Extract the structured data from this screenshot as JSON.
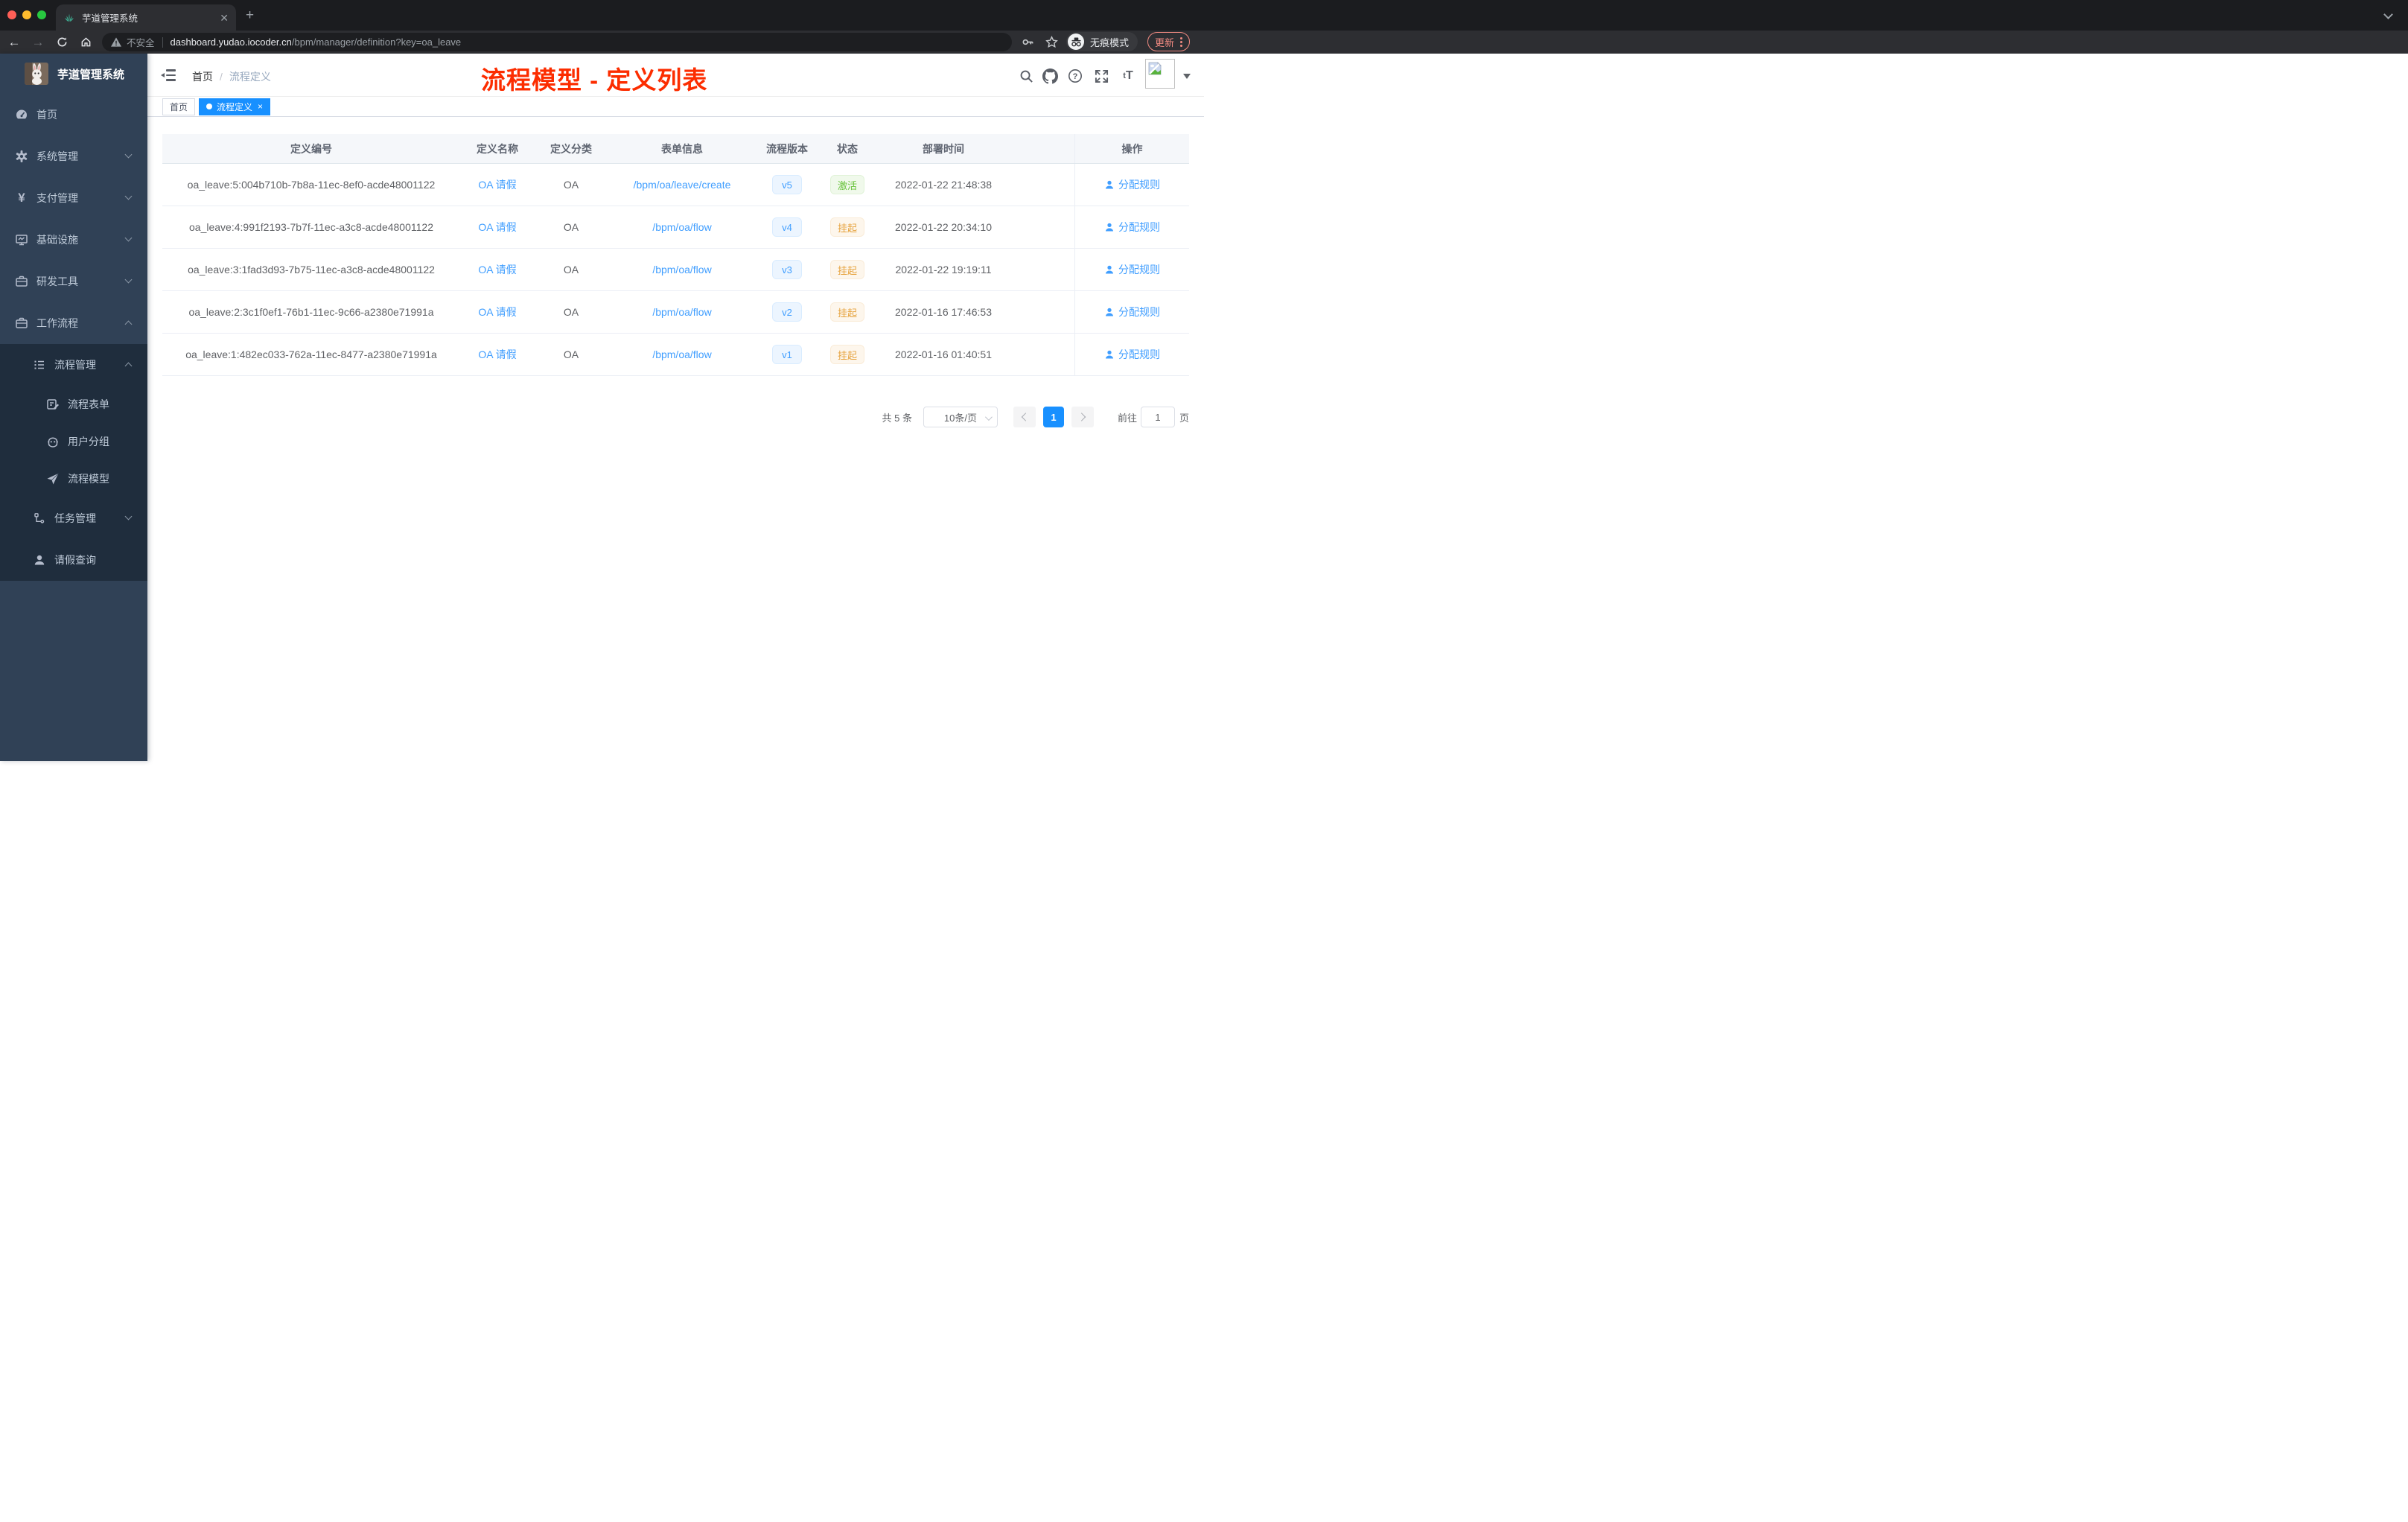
{
  "browser": {
    "tab_title": "芋道管理系统",
    "new_tab": "+",
    "security_label": "不安全",
    "url_host": "dashboard.yudao.iocoder.cn",
    "url_path": "/bpm/manager/definition?key=oa_leave",
    "incognito_label": "无痕模式",
    "update_label": "更新"
  },
  "sidebar": {
    "brand": "芋道管理系统",
    "items": [
      {
        "label": "首页",
        "icon": "dashboard-icon",
        "level": 1
      },
      {
        "label": "系统管理",
        "icon": "gear-icon",
        "level": 1,
        "chevron": "down"
      },
      {
        "label": "支付管理",
        "icon": "yen-icon",
        "level": 1,
        "chevron": "down"
      },
      {
        "label": "基础设施",
        "icon": "monitor-icon",
        "level": 1,
        "chevron": "down"
      },
      {
        "label": "研发工具",
        "icon": "toolbox-icon",
        "level": 1,
        "chevron": "down"
      },
      {
        "label": "工作流程",
        "icon": "toolbox-icon",
        "level": 1,
        "chevron": "up"
      },
      {
        "label": "流程管理",
        "icon": "list-tree-icon",
        "level": 2,
        "chevron": "up"
      },
      {
        "label": "流程表单",
        "icon": "form-pen-icon",
        "level": 3
      },
      {
        "label": "用户分组",
        "icon": "robot-icon",
        "level": 3
      },
      {
        "label": "流程模型",
        "icon": "paper-plane-icon",
        "level": 3
      },
      {
        "label": "任务管理",
        "icon": "branch-icon",
        "level": 2,
        "chevron": "down"
      },
      {
        "label": "请假查询",
        "icon": "person-icon",
        "level": 2
      }
    ]
  },
  "header": {
    "breadcrumb": {
      "home": "首页",
      "separator": "/",
      "current": "流程定义"
    },
    "annotation": "流程模型 - 定义列表",
    "font_size_tool": "tT"
  },
  "tags": [
    {
      "label": "首页",
      "active": false
    },
    {
      "label": "流程定义",
      "active": true,
      "close": "×"
    }
  ],
  "table": {
    "columns": [
      "定义编号",
      "定义名称",
      "定义分类",
      "表单信息",
      "流程版本",
      "状态",
      "部署时间",
      "操作"
    ],
    "rows": [
      {
        "id": "oa_leave:5:004b710b-7b8a-11ec-8ef0-acde48001122",
        "name": "OA 请假",
        "category": "OA",
        "form": "/bpm/oa/leave/create",
        "version": "v5",
        "status": "激活",
        "status_type": "active",
        "time": "2022-01-22 21:48:38",
        "action": "分配规则"
      },
      {
        "id": "oa_leave:4:991f2193-7b7f-11ec-a3c8-acde48001122",
        "name": "OA 请假",
        "category": "OA",
        "form": "/bpm/oa/flow",
        "version": "v4",
        "status": "挂起",
        "status_type": "suspended",
        "time": "2022-01-22 20:34:10",
        "action": "分配规则"
      },
      {
        "id": "oa_leave:3:1fad3d93-7b75-11ec-a3c8-acde48001122",
        "name": "OA 请假",
        "category": "OA",
        "form": "/bpm/oa/flow",
        "version": "v3",
        "status": "挂起",
        "status_type": "suspended",
        "time": "2022-01-22 19:19:11",
        "action": "分配规则"
      },
      {
        "id": "oa_leave:2:3c1f0ef1-76b1-11ec-9c66-a2380e71991a",
        "name": "OA 请假",
        "category": "OA",
        "form": "/bpm/oa/flow",
        "version": "v2",
        "status": "挂起",
        "status_type": "suspended",
        "time": "2022-01-16 17:46:53",
        "action": "分配规则"
      },
      {
        "id": "oa_leave:1:482ec033-762a-11ec-8477-a2380e71991a",
        "name": "OA 请假",
        "category": "OA",
        "form": "/bpm/oa/flow",
        "version": "v1",
        "status": "挂起",
        "status_type": "suspended",
        "time": "2022-01-16 01:40:51",
        "action": "分配规则"
      }
    ]
  },
  "pagination": {
    "total": "共 5 条",
    "page_size": "10条/页",
    "current_page": "1",
    "goto_label": "前往",
    "goto_value": "1",
    "unit": "页"
  },
  "colors": {
    "accent_blue": "#1890ff",
    "link_blue": "#409eff",
    "active_green": "#67c23a",
    "suspended_yellow": "#e6a23c",
    "annotation_red": "#fc2d00",
    "sidebar_bg": "#304156",
    "submenu_bg": "#1f2d3d"
  }
}
